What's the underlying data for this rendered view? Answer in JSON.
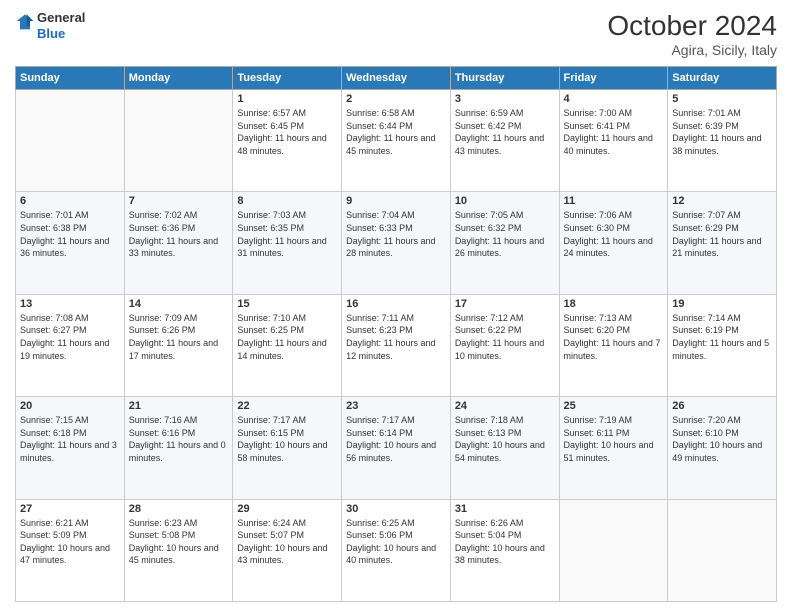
{
  "header": {
    "logo": {
      "general": "General",
      "blue": "Blue"
    },
    "title": "October 2024",
    "location": "Agira, Sicily, Italy"
  },
  "days_of_week": [
    "Sunday",
    "Monday",
    "Tuesday",
    "Wednesday",
    "Thursday",
    "Friday",
    "Saturday"
  ],
  "weeks": [
    [
      null,
      null,
      {
        "day": 1,
        "sunrise": "6:57 AM",
        "sunset": "6:45 PM",
        "daylight": "11 hours and 48 minutes."
      },
      {
        "day": 2,
        "sunrise": "6:58 AM",
        "sunset": "6:44 PM",
        "daylight": "11 hours and 45 minutes."
      },
      {
        "day": 3,
        "sunrise": "6:59 AM",
        "sunset": "6:42 PM",
        "daylight": "11 hours and 43 minutes."
      },
      {
        "day": 4,
        "sunrise": "7:00 AM",
        "sunset": "6:41 PM",
        "daylight": "11 hours and 40 minutes."
      },
      {
        "day": 5,
        "sunrise": "7:01 AM",
        "sunset": "6:39 PM",
        "daylight": "11 hours and 38 minutes."
      }
    ],
    [
      {
        "day": 6,
        "sunrise": "7:01 AM",
        "sunset": "6:38 PM",
        "daylight": "11 hours and 36 minutes."
      },
      {
        "day": 7,
        "sunrise": "7:02 AM",
        "sunset": "6:36 PM",
        "daylight": "11 hours and 33 minutes."
      },
      {
        "day": 8,
        "sunrise": "7:03 AM",
        "sunset": "6:35 PM",
        "daylight": "11 hours and 31 minutes."
      },
      {
        "day": 9,
        "sunrise": "7:04 AM",
        "sunset": "6:33 PM",
        "daylight": "11 hours and 28 minutes."
      },
      {
        "day": 10,
        "sunrise": "7:05 AM",
        "sunset": "6:32 PM",
        "daylight": "11 hours and 26 minutes."
      },
      {
        "day": 11,
        "sunrise": "7:06 AM",
        "sunset": "6:30 PM",
        "daylight": "11 hours and 24 minutes."
      },
      {
        "day": 12,
        "sunrise": "7:07 AM",
        "sunset": "6:29 PM",
        "daylight": "11 hours and 21 minutes."
      }
    ],
    [
      {
        "day": 13,
        "sunrise": "7:08 AM",
        "sunset": "6:27 PM",
        "daylight": "11 hours and 19 minutes."
      },
      {
        "day": 14,
        "sunrise": "7:09 AM",
        "sunset": "6:26 PM",
        "daylight": "11 hours and 17 minutes."
      },
      {
        "day": 15,
        "sunrise": "7:10 AM",
        "sunset": "6:25 PM",
        "daylight": "11 hours and 14 minutes."
      },
      {
        "day": 16,
        "sunrise": "7:11 AM",
        "sunset": "6:23 PM",
        "daylight": "11 hours and 12 minutes."
      },
      {
        "day": 17,
        "sunrise": "7:12 AM",
        "sunset": "6:22 PM",
        "daylight": "11 hours and 10 minutes."
      },
      {
        "day": 18,
        "sunrise": "7:13 AM",
        "sunset": "6:20 PM",
        "daylight": "11 hours and 7 minutes."
      },
      {
        "day": 19,
        "sunrise": "7:14 AM",
        "sunset": "6:19 PM",
        "daylight": "11 hours and 5 minutes."
      }
    ],
    [
      {
        "day": 20,
        "sunrise": "7:15 AM",
        "sunset": "6:18 PM",
        "daylight": "11 hours and 3 minutes."
      },
      {
        "day": 21,
        "sunrise": "7:16 AM",
        "sunset": "6:16 PM",
        "daylight": "11 hours and 0 minutes."
      },
      {
        "day": 22,
        "sunrise": "7:17 AM",
        "sunset": "6:15 PM",
        "daylight": "10 hours and 58 minutes."
      },
      {
        "day": 23,
        "sunrise": "7:17 AM",
        "sunset": "6:14 PM",
        "daylight": "10 hours and 56 minutes."
      },
      {
        "day": 24,
        "sunrise": "7:18 AM",
        "sunset": "6:13 PM",
        "daylight": "10 hours and 54 minutes."
      },
      {
        "day": 25,
        "sunrise": "7:19 AM",
        "sunset": "6:11 PM",
        "daylight": "10 hours and 51 minutes."
      },
      {
        "day": 26,
        "sunrise": "7:20 AM",
        "sunset": "6:10 PM",
        "daylight": "10 hours and 49 minutes."
      }
    ],
    [
      {
        "day": 27,
        "sunrise": "6:21 AM",
        "sunset": "5:09 PM",
        "daylight": "10 hours and 47 minutes."
      },
      {
        "day": 28,
        "sunrise": "6:23 AM",
        "sunset": "5:08 PM",
        "daylight": "10 hours and 45 minutes."
      },
      {
        "day": 29,
        "sunrise": "6:24 AM",
        "sunset": "5:07 PM",
        "daylight": "10 hours and 43 minutes."
      },
      {
        "day": 30,
        "sunrise": "6:25 AM",
        "sunset": "5:06 PM",
        "daylight": "10 hours and 40 minutes."
      },
      {
        "day": 31,
        "sunrise": "6:26 AM",
        "sunset": "5:04 PM",
        "daylight": "10 hours and 38 minutes."
      },
      null,
      null
    ]
  ],
  "labels": {
    "sunrise_prefix": "Sunrise:",
    "sunset_prefix": "Sunset:",
    "daylight_prefix": "Daylight:"
  }
}
